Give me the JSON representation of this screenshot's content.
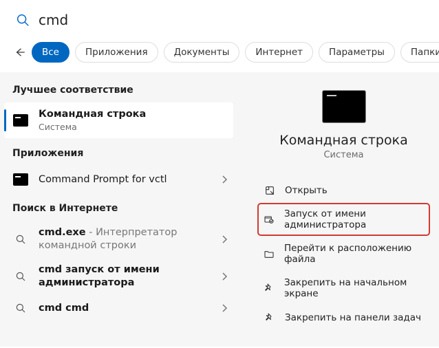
{
  "search": {
    "value": "cmd",
    "placeholder": ""
  },
  "filters": {
    "items": [
      {
        "label": "Все",
        "active": true
      },
      {
        "label": "Приложения",
        "active": false
      },
      {
        "label": "Документы",
        "active": false
      },
      {
        "label": "Интернет",
        "active": false
      },
      {
        "label": "Параметры",
        "active": false
      },
      {
        "label": "Папки",
        "active": false
      }
    ]
  },
  "sections": {
    "best_match": "Лучшее соответствие",
    "apps": "Приложения",
    "web_search": "Поиск в Интернете"
  },
  "results": {
    "best": {
      "title": "Командная строка",
      "subtitle": "Система"
    },
    "apps": [
      {
        "title": "Command Prompt for vctl"
      }
    ],
    "web": [
      {
        "term": "cmd.exe",
        "desc": " - Интерпретатор командной строки"
      },
      {
        "term": "cmd запуск от имени администратора",
        "desc": ""
      },
      {
        "term": "cmd cmd",
        "desc": ""
      }
    ]
  },
  "preview": {
    "title": "Командная строка",
    "subtitle": "Система",
    "actions": [
      {
        "label": "Открыть",
        "icon": "open"
      },
      {
        "label": "Запуск от имени администратора",
        "icon": "admin",
        "highlighted": true
      },
      {
        "label": "Перейти к расположению файла",
        "icon": "folder"
      },
      {
        "label": "Закрепить на начальном экране",
        "icon": "pin"
      },
      {
        "label": "Закрепить на панели задач",
        "icon": "pin"
      }
    ]
  }
}
